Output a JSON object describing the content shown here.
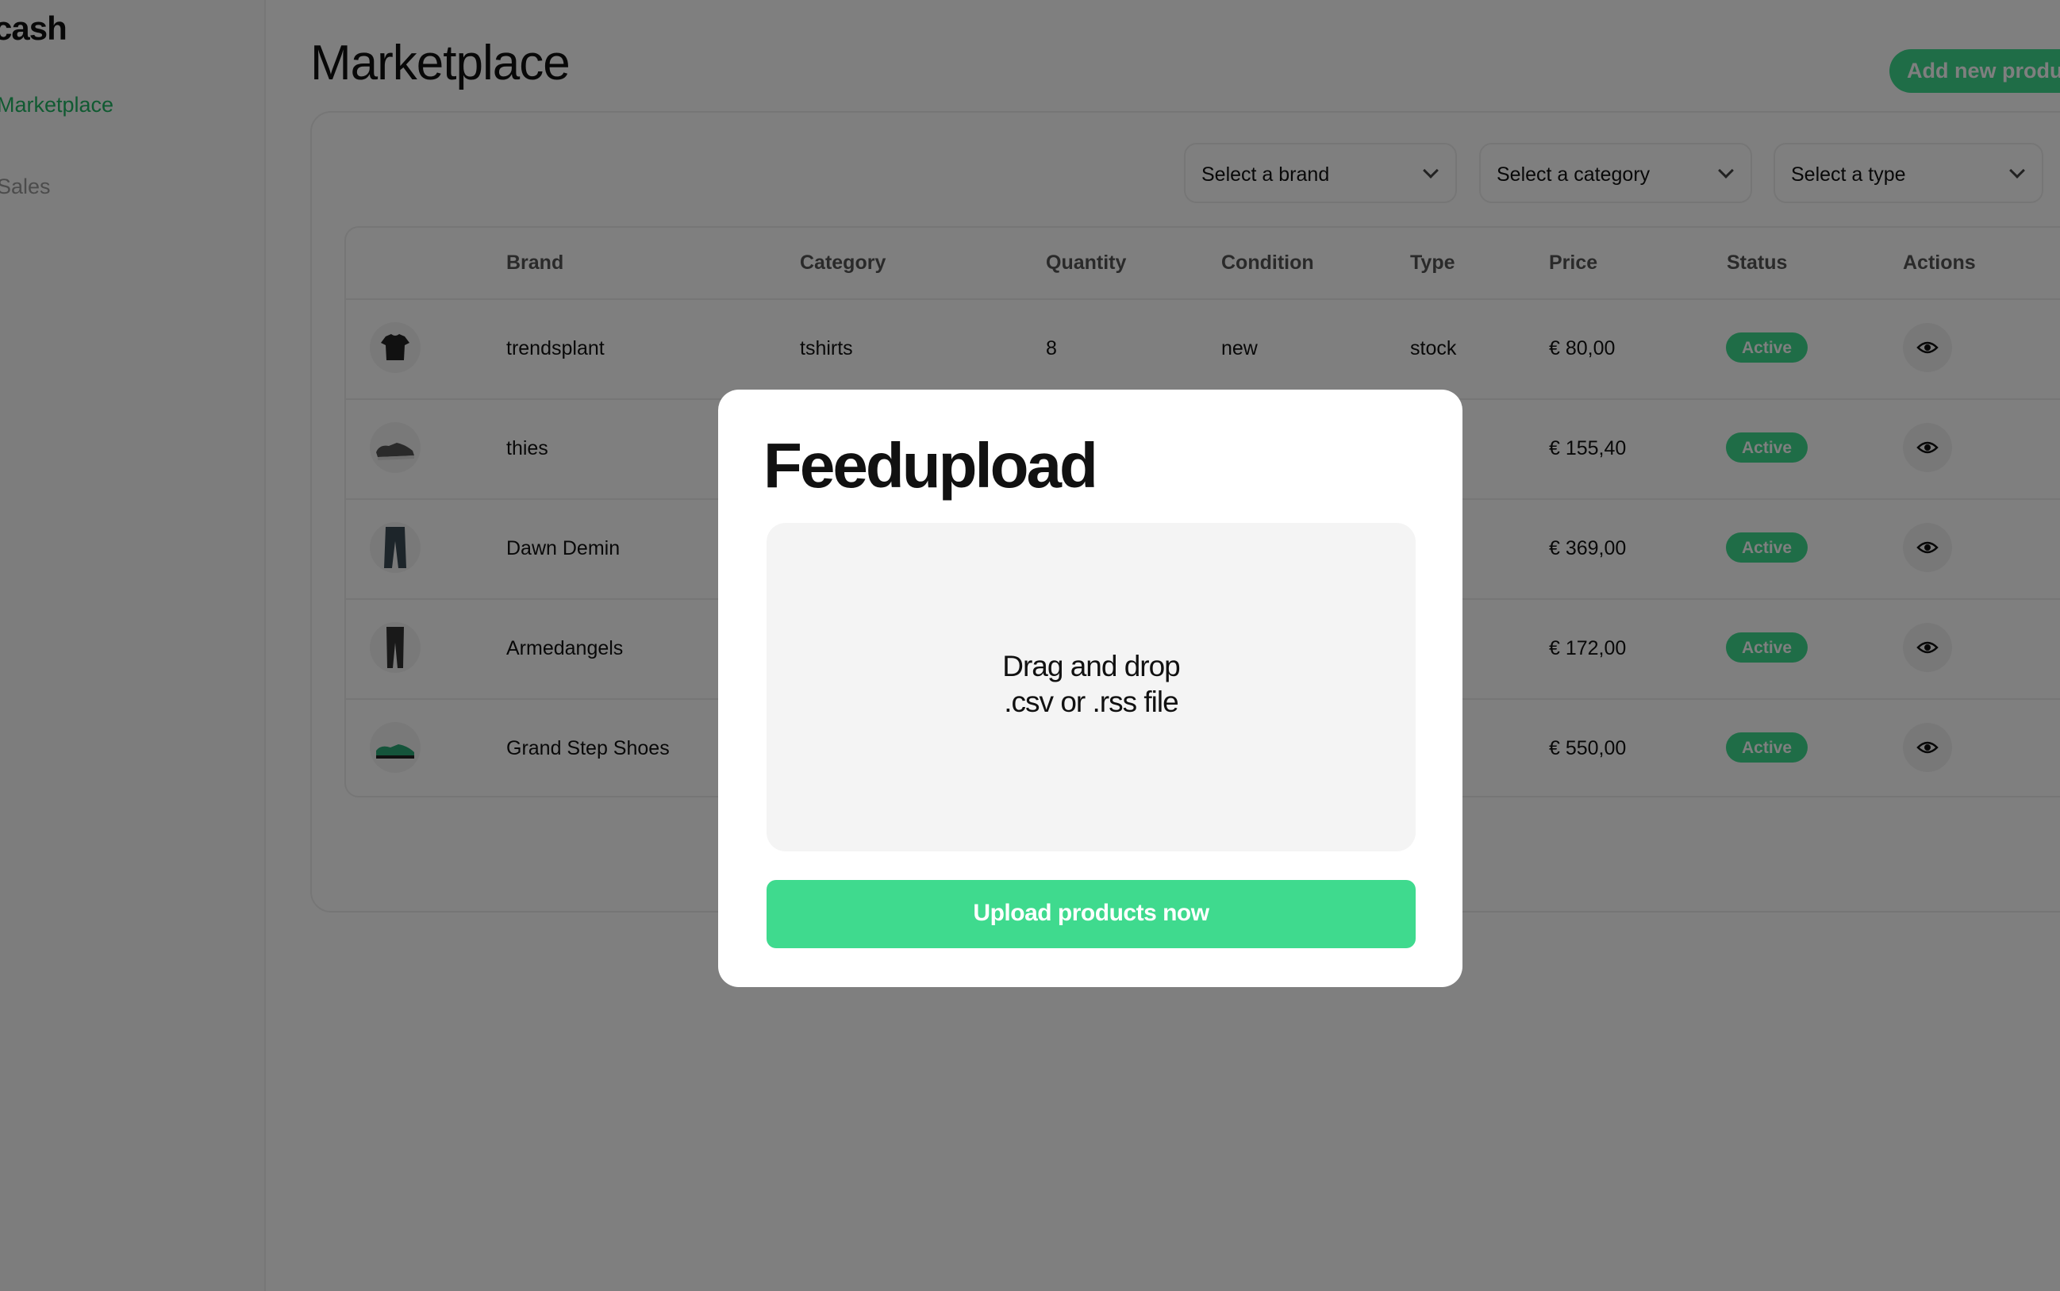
{
  "sidebar": {
    "logo": "cash",
    "items": [
      {
        "label": "Marketplace"
      },
      {
        "label": "Sales"
      }
    ]
  },
  "header": {
    "title": "Marketplace",
    "add_button": "Add new product"
  },
  "filters": {
    "brand": "Select a brand",
    "category": "Select a category",
    "type": "Select a type"
  },
  "table": {
    "columns": [
      "Brand",
      "Category",
      "Quantity",
      "Condition",
      "Type",
      "Price",
      "Status",
      "Actions"
    ],
    "rows": [
      {
        "brand": "trendsplant",
        "category": "tshirts",
        "quantity": "8",
        "condition": "new",
        "type": "stock",
        "price": "€ 80,00",
        "status": "Active",
        "image": "tshirt-icon"
      },
      {
        "brand": "thies",
        "price": "€ 155,40",
        "status": "Active",
        "image": "sneaker-icon"
      },
      {
        "brand": "Dawn Demin",
        "price": "€ 369,00",
        "status": "Active",
        "image": "jeans-icon"
      },
      {
        "brand": "Armedangels",
        "price": "€ 172,00",
        "status": "Active",
        "image": "pants-icon"
      },
      {
        "brand": "Grand Step Shoes",
        "price": "€ 550,00",
        "status": "Active",
        "image": "shoe-icon"
      }
    ]
  },
  "modal": {
    "title": "Feedupload",
    "drop_line1": "Drag and drop",
    "drop_line2": ".csv or .rss file",
    "upload_button": "Upload products now"
  },
  "colors": {
    "accent": "#3fda8e",
    "nav_active": "#21b463",
    "overlay": "rgba(0,0,0,0.5)"
  }
}
